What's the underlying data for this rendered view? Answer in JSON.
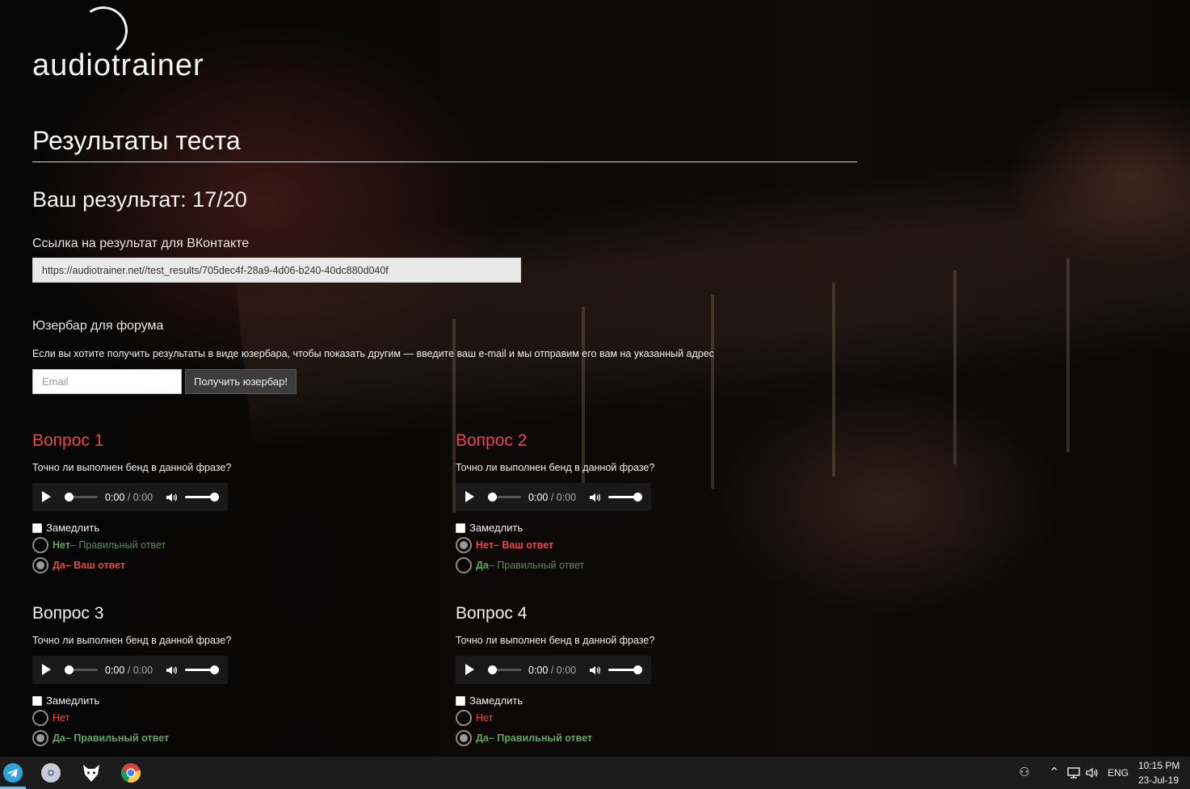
{
  "brand": {
    "logo_text": "audiotrainer"
  },
  "page_title": "Результаты теста",
  "score": {
    "label": "Ваш результат: 17/20"
  },
  "vk": {
    "label": "Ссылка на результат для ВКонтакте",
    "link": "https://audiotrainer.net//test_results/705dec4f-28a9-4d06-b240-40dc880d040f"
  },
  "userbar": {
    "label": "Юзербар для форума",
    "description": "Если вы хотите получить результаты в виде юзербара, чтобы показать другим — введите ваш e-mail и мы отправим его вам на указанный адрес",
    "email_placeholder": "Email",
    "button_label": "Получить юзербар!"
  },
  "questions": [
    {
      "title": "Вопрос 1",
      "title_color": "#e8474d",
      "text": "Точно ли выполнен бенд в данной фразе?",
      "player": {
        "current": "0:00",
        "separator": "/",
        "duration": "0:00"
      },
      "slow_label": "Замедлить",
      "answers": [
        {
          "label": "Нет",
          "note": " – Правильный ответ",
          "selected": false
        },
        {
          "label": "Да",
          "note": " – Ваш ответ",
          "selected": true
        }
      ]
    },
    {
      "title": "Вопрос 2",
      "title_color": "#e8474d",
      "text": "Точно ли выполнен бенд в данной фразе?",
      "player": {
        "current": "0:00",
        "separator": "/",
        "duration": "0:00"
      },
      "slow_label": "Замедлить",
      "answers": [
        {
          "label": "Нет",
          "note": " – Ваш ответ",
          "selected": true
        },
        {
          "label": "Да",
          "note": " – Правильный ответ",
          "selected": false
        }
      ]
    },
    {
      "title": "Вопрос 3",
      "title_color": "#f0f0f0",
      "text": "Точно ли выполнен бенд в данной фразе?",
      "player": {
        "current": "0:00",
        "separator": "/",
        "duration": "0:00"
      },
      "slow_label": "Замедлить",
      "answers": [
        {
          "label": "Нет",
          "note": "",
          "selected": false
        },
        {
          "label": "Да",
          "note": " – Правильный ответ",
          "selected": true
        }
      ]
    },
    {
      "title": "Вопрос 4",
      "title_color": "#f0f0f0",
      "text": "Точно ли выполнен бенд в данной фразе?",
      "player": {
        "current": "0:00",
        "separator": "/",
        "duration": "0:00"
      },
      "slow_label": "Замедлить",
      "answers": [
        {
          "label": "Нет",
          "note": "",
          "selected": false
        },
        {
          "label": "Да",
          "note": " – Правильный ответ",
          "selected": true
        }
      ]
    }
  ],
  "taskbar": {
    "apps": [
      "telegram-icon",
      "dvd-icon",
      "fox-icon",
      "chrome-icon"
    ],
    "tray": {
      "language": "ENG",
      "time": "10:15 PM",
      "date": "23-Jul-19"
    }
  },
  "colors": {
    "accent_red": "#e8474d",
    "correct_green": "#5fa85f",
    "taskbar": "#1c1c1c"
  }
}
